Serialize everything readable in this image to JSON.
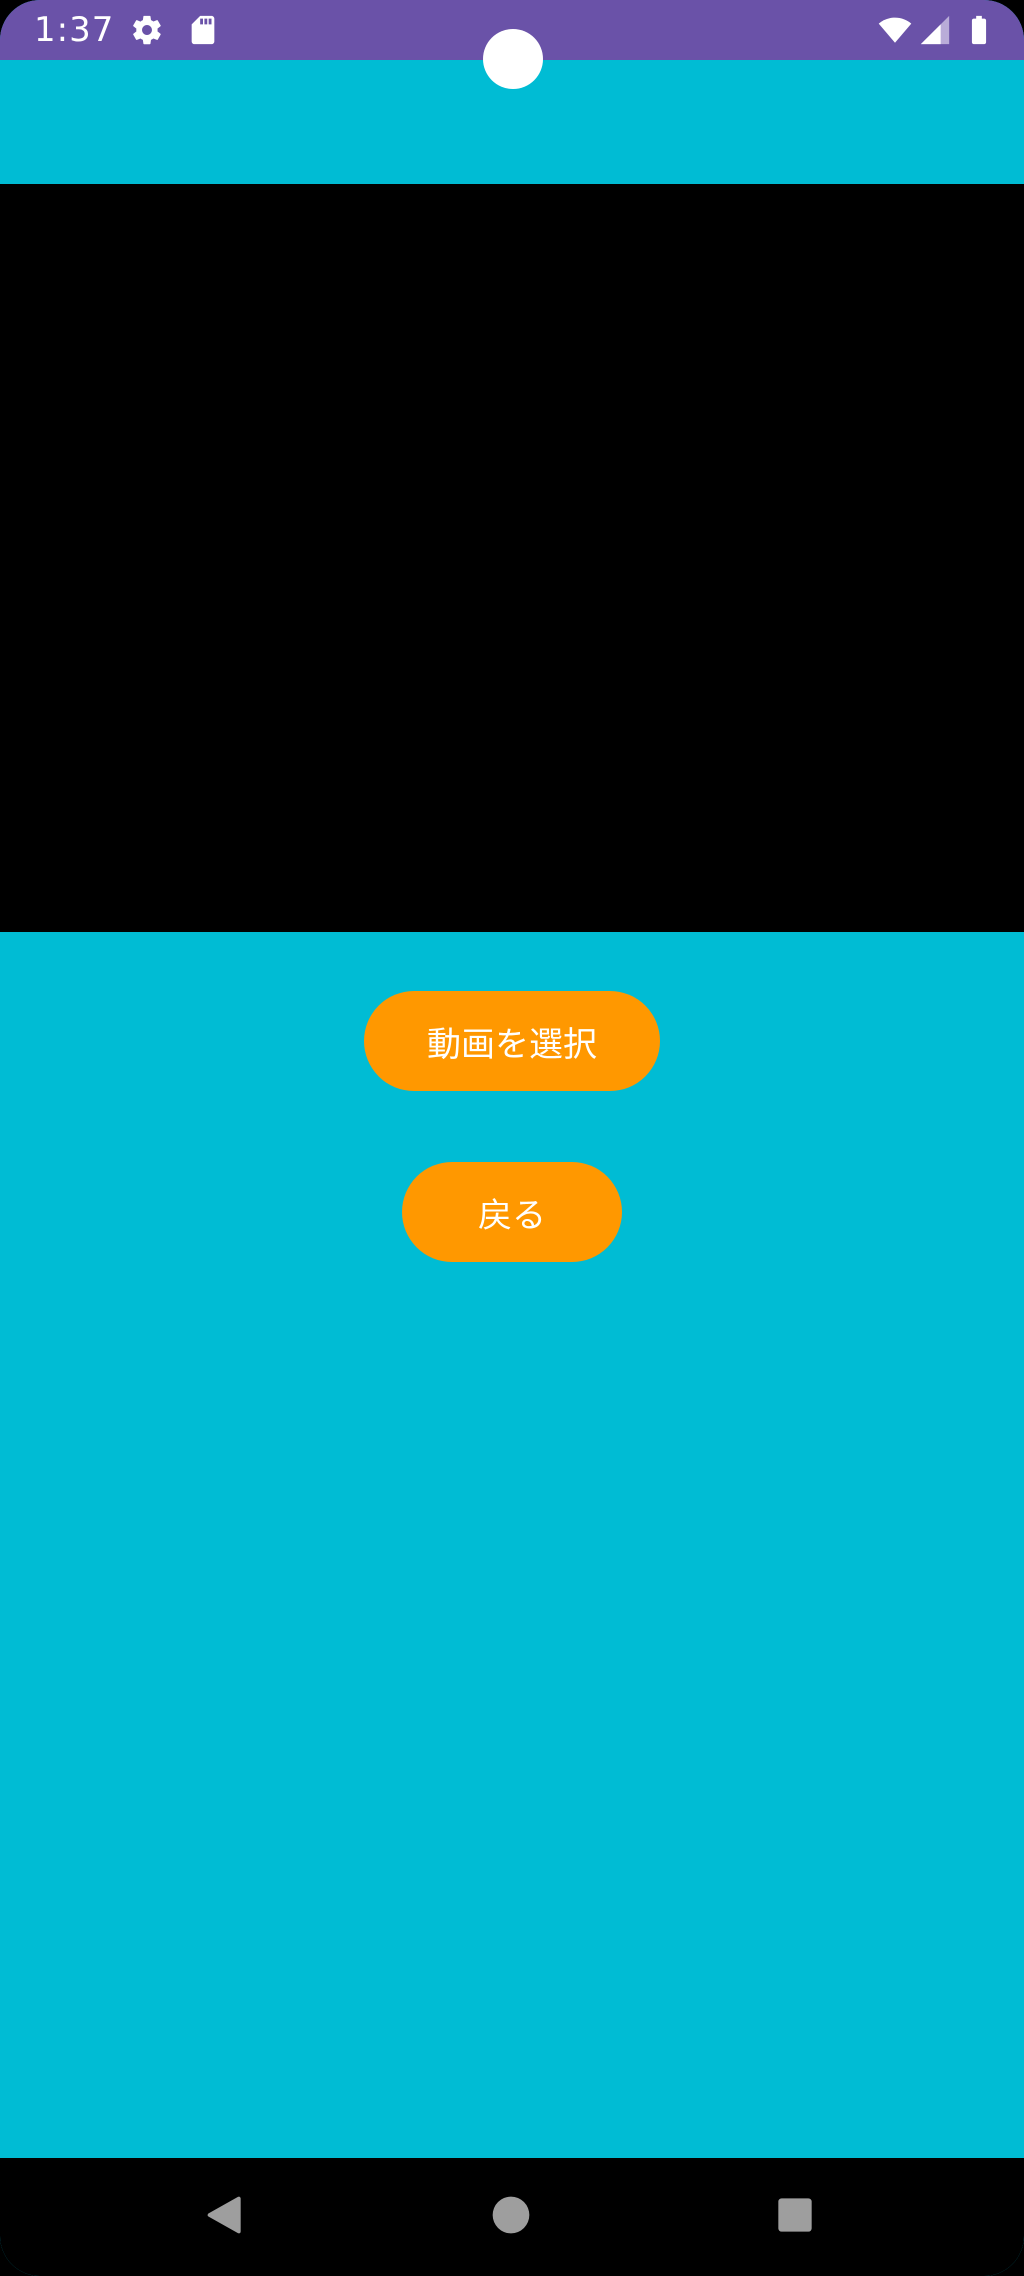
{
  "status_bar": {
    "time": "1:37",
    "icons": [
      "gear-icon",
      "sd-card-icon",
      "wifi-icon",
      "signal-icon",
      "battery-icon"
    ],
    "color": "#6a52a8"
  },
  "colors": {
    "background": "#00bcd4",
    "video": "#000000",
    "button": "#ff9800",
    "button_text": "#ffffff",
    "nav_bar": "#000000",
    "nav_icon": "#9e9e9e"
  },
  "buttons": {
    "select_video": "動画を選択",
    "back": "戻る"
  },
  "nav_bar": {
    "items": [
      "back-icon",
      "home-icon",
      "recents-icon"
    ]
  }
}
